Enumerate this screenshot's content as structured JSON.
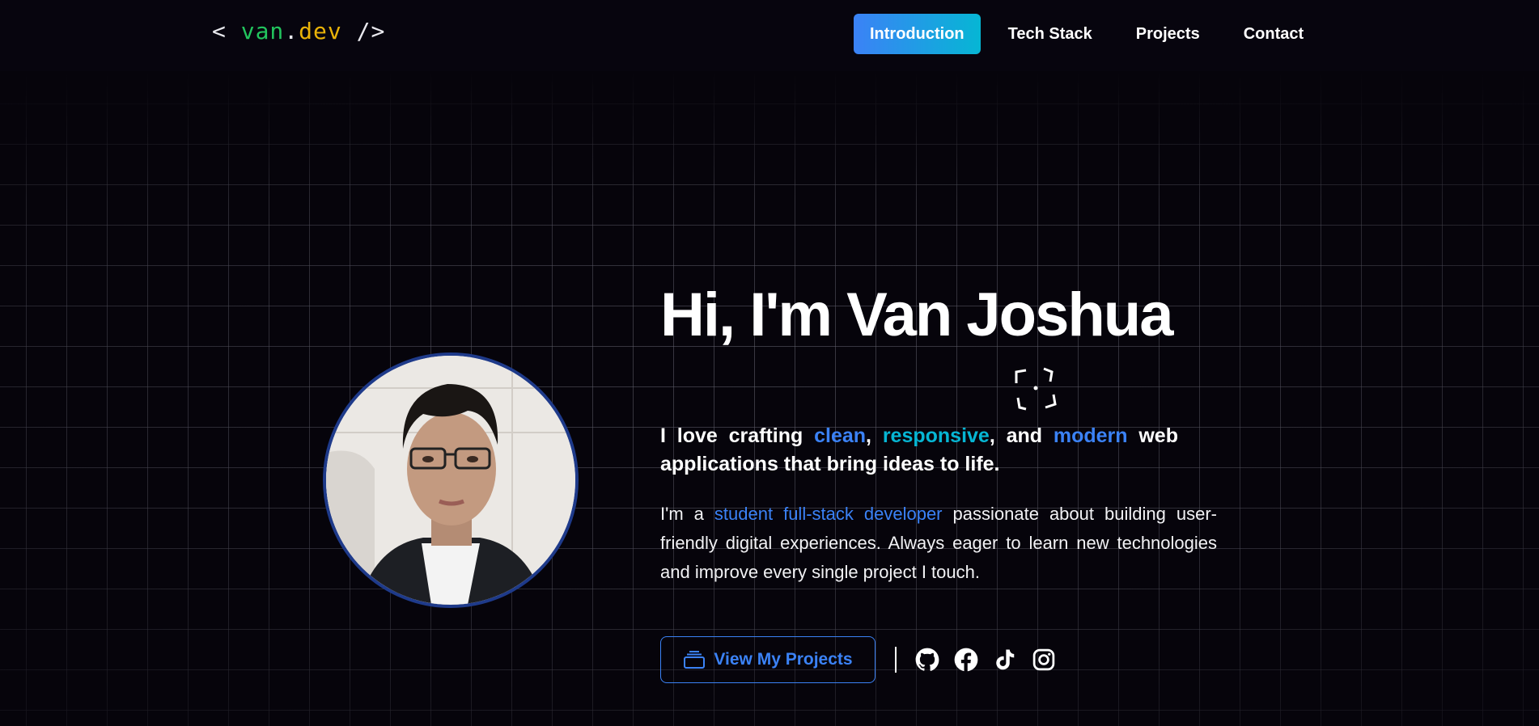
{
  "logo": {
    "open": "<",
    "name_a": "van",
    "dot": ".",
    "name_b": "dev",
    "close": "/>"
  },
  "nav": [
    {
      "label": "Introduction",
      "active": true
    },
    {
      "label": "Tech Stack"
    },
    {
      "label": "Projects"
    },
    {
      "label": "Contact"
    }
  ],
  "hero": {
    "title": "Hi, I'm Van Joshua",
    "tagline": {
      "t1": "I love crafting ",
      "clean": "clean",
      "comma": ", ",
      "responsive": "responsive",
      "and": ", and ",
      "modern": "modern",
      "t2": " web applications that bring ideas to life."
    },
    "bio": {
      "pre": "I'm a ",
      "role": "student full-stack developer",
      "post": " passionate about building user-friendly digital experiences. Always eager to learn new technologies and improve every single project I touch."
    },
    "cta_label": "View My Projects"
  },
  "social_icons": [
    "github-icon",
    "facebook-icon",
    "tiktok-icon",
    "instagram-icon"
  ],
  "colors": {
    "accent_blue": "#3b82f6",
    "accent_cyan": "#06b6d4",
    "logo_green": "#22c55e",
    "logo_yellow": "#eab308",
    "avatar_border": "#1e3a8a",
    "background": "#06040b"
  }
}
